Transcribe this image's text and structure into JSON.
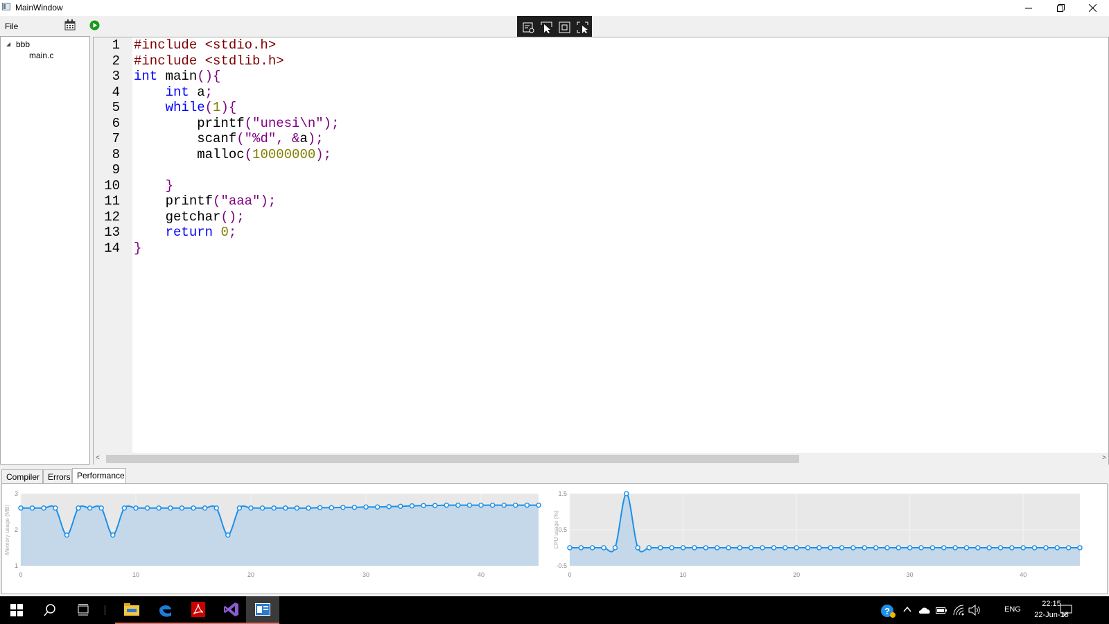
{
  "window": {
    "title": "MainWindow"
  },
  "menu": {
    "file": "File"
  },
  "tree": {
    "project": "bbb",
    "file": "main.c"
  },
  "editor": {
    "lines": [
      [
        [
          "pp",
          "#include <stdio.h>"
        ]
      ],
      [
        [
          "pp",
          "#include <stdlib.h>"
        ]
      ],
      [
        [
          "kw",
          "int"
        ],
        [
          "tx",
          " main"
        ],
        [
          "pn",
          "(){"
        ]
      ],
      [
        [
          "tx",
          "    "
        ],
        [
          "kw",
          "int"
        ],
        [
          "tx",
          " a"
        ],
        [
          "pn",
          ";"
        ]
      ],
      [
        [
          "tx",
          "    "
        ],
        [
          "kw",
          "while"
        ],
        [
          "pn",
          "("
        ],
        [
          "nm",
          "1"
        ],
        [
          "pn",
          "){"
        ]
      ],
      [
        [
          "tx",
          "        printf"
        ],
        [
          "pn",
          "("
        ],
        [
          "st",
          "\"unesi\\n\""
        ],
        [
          "pn",
          ");"
        ]
      ],
      [
        [
          "tx",
          "        scanf"
        ],
        [
          "pn",
          "("
        ],
        [
          "st",
          "\"%d\""
        ],
        [
          "pn",
          ", &"
        ],
        [
          "tx",
          "a"
        ],
        [
          "pn",
          ");"
        ]
      ],
      [
        [
          "tx",
          "        malloc"
        ],
        [
          "pn",
          "("
        ],
        [
          "nm",
          "10000000"
        ],
        [
          "pn",
          ");"
        ]
      ],
      [],
      [
        [
          "tx",
          "    "
        ],
        [
          "pn",
          "}"
        ]
      ],
      [
        [
          "tx",
          "    printf"
        ],
        [
          "pn",
          "("
        ],
        [
          "st",
          "\"aaa\""
        ],
        [
          "pn",
          ");"
        ]
      ],
      [
        [
          "tx",
          "    getchar"
        ],
        [
          "pn",
          "();"
        ]
      ],
      [
        [
          "tx",
          "    "
        ],
        [
          "kw",
          "return"
        ],
        [
          "tx",
          " "
        ],
        [
          "nm",
          "0"
        ],
        [
          "pn",
          ";"
        ]
      ],
      [
        [
          "pn",
          "}"
        ]
      ]
    ]
  },
  "tabs": [
    "Compiler",
    "Errors",
    "Performance"
  ],
  "active_tab": "Performance",
  "colors": {
    "series": "#1e90e6",
    "area": "#c5d8ea",
    "plot_bg": "#e8e8e8"
  },
  "chart_data": [
    {
      "type": "area",
      "ylabel": "Memory usage (MB)",
      "ylim": [
        1,
        3
      ],
      "y_ticks": [
        1,
        2,
        3
      ],
      "xlim": [
        0,
        45
      ],
      "x_ticks": [
        0,
        10,
        20,
        30,
        40
      ],
      "grid": true,
      "x": [
        0,
        1,
        2,
        3,
        4,
        5,
        6,
        7,
        8,
        9,
        10,
        11,
        12,
        13,
        14,
        15,
        16,
        17,
        18,
        19,
        20,
        21,
        22,
        23,
        24,
        25,
        26,
        27,
        28,
        29,
        30,
        31,
        32,
        33,
        34,
        35,
        36,
        37,
        38,
        39,
        40,
        41,
        42,
        43,
        44,
        45
      ],
      "values": [
        2.6,
        2.6,
        2.6,
        2.6,
        1.85,
        2.6,
        2.6,
        2.6,
        1.85,
        2.6,
        2.6,
        2.6,
        2.6,
        2.6,
        2.6,
        2.6,
        2.6,
        2.6,
        1.85,
        2.6,
        2.6,
        2.6,
        2.6,
        2.6,
        2.6,
        2.6,
        2.61,
        2.61,
        2.62,
        2.62,
        2.63,
        2.63,
        2.64,
        2.65,
        2.66,
        2.67,
        2.67,
        2.68,
        2.68,
        2.68,
        2.68,
        2.68,
        2.68,
        2.68,
        2.68,
        2.68
      ]
    },
    {
      "type": "area",
      "ylabel": "CPU usage (%)",
      "ylim": [
        -0.5,
        1.5
      ],
      "y_ticks": [
        -0.5,
        0.5,
        1.5
      ],
      "xlim": [
        0,
        45
      ],
      "x_ticks": [
        0,
        10,
        20,
        30,
        40
      ],
      "grid": true,
      "x": [
        0,
        1,
        2,
        3,
        4,
        5,
        6,
        7,
        8,
        9,
        10,
        11,
        12,
        13,
        14,
        15,
        16,
        17,
        18,
        19,
        20,
        21,
        22,
        23,
        24,
        25,
        26,
        27,
        28,
        29,
        30,
        31,
        32,
        33,
        34,
        35,
        36,
        37,
        38,
        39,
        40,
        41,
        42,
        43,
        44,
        45
      ],
      "values": [
        0,
        0,
        0,
        0,
        0,
        1.5,
        0,
        0,
        0,
        0,
        0,
        0,
        0,
        0,
        0,
        0,
        0,
        0,
        0,
        0,
        0,
        0,
        0,
        0,
        0,
        0,
        0,
        0,
        0,
        0,
        0,
        0,
        0,
        0,
        0,
        0,
        0,
        0,
        0,
        0,
        0,
        0,
        0,
        0,
        0,
        0
      ]
    }
  ],
  "taskbar": {
    "apps": [
      "windows-start-icon",
      "search-icon",
      "task-view-icon",
      "file-explorer-icon",
      "edge-browser-icon",
      "pdf-reader-icon",
      "visual-studio-icon",
      "mainwindow-app-icon"
    ],
    "lang": "ENG",
    "time": "22:15",
    "date": "22-Jun-18"
  }
}
